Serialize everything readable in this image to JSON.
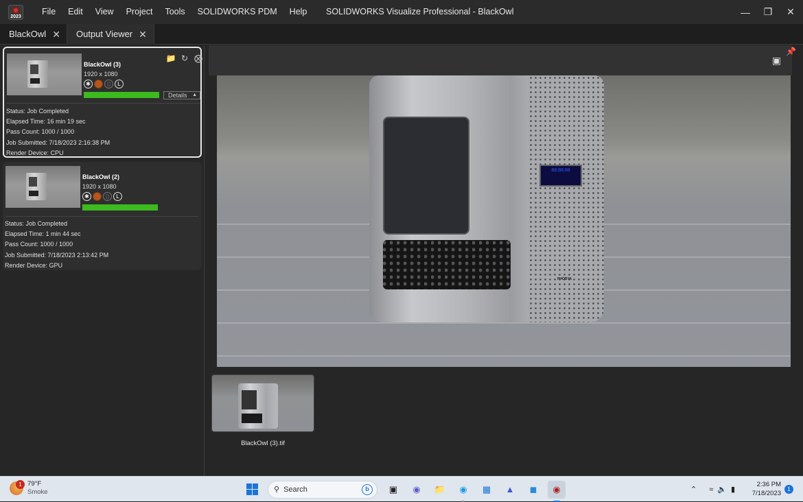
{
  "window": {
    "title": "SOLIDWORKS Visualize Professional - BlackOwl",
    "logo_year": "2023",
    "menu": [
      "File",
      "Edit",
      "View",
      "Project",
      "Tools",
      "SOLIDWORKS PDM",
      "Help"
    ]
  },
  "tabs": [
    {
      "label": "BlackOwl",
      "active": false
    },
    {
      "label": "Output Viewer",
      "active": true
    }
  ],
  "jobs": [
    {
      "name": "BlackOwl (3)",
      "resolution": "1920 x 1080",
      "progress": 1.0,
      "details_label": "Details",
      "status": "Status: Job Completed",
      "elapsed": "Elapsed Time: 16 min 19 sec",
      "pass_count": "Pass Count: 1000 / 1000",
      "submitted": "Job Submitted: 7/18/2023 2:16:38 PM",
      "device": "Render Device: CPU"
    },
    {
      "name": "BlackOwl (2)",
      "resolution": "1920 x 1080",
      "progress": 1.0,
      "status": "Status: Job Completed",
      "elapsed": "Elapsed Time: 1 min 44 sec",
      "pass_count": "Pass Count: 1000 / 1000",
      "submitted": "Job Submitted: 7/18/2023 2:13:42 PM",
      "device": "Render Device: GPU"
    }
  ],
  "viewer": {
    "screen_text": "88:88:88",
    "brand_text": "PHOBYA",
    "filmstrip": [
      {
        "label": "BlackOwl (3).tif"
      }
    ]
  },
  "taskbar": {
    "weather_temp": "79°F",
    "weather_desc": "Smoke",
    "weather_badge": "1",
    "search_placeholder": "Search",
    "time": "2:36 PM",
    "date": "7/18/2023",
    "notification_count": "1",
    "accent": "#1b74d8"
  }
}
